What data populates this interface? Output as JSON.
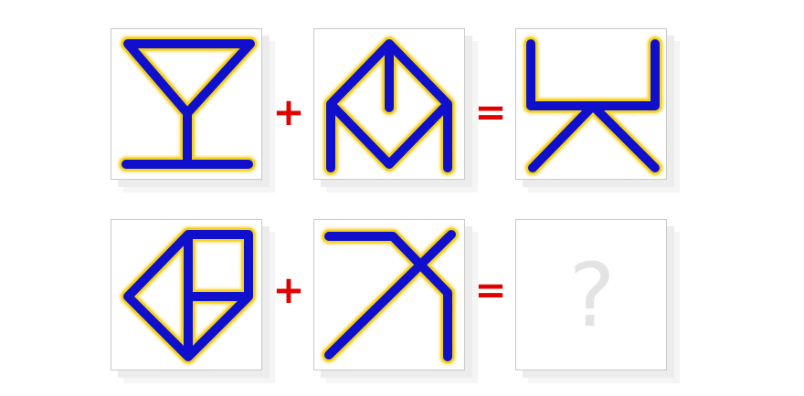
{
  "puzzle": {
    "row1": {
      "plus": "+",
      "equals": "="
    },
    "row2": {
      "plus": "+",
      "equals": "=",
      "answer": "?"
    }
  },
  "colors": {
    "stroke_core": "#1010cc",
    "stroke_glow": "#f2d21b",
    "operator": "#e00000",
    "placeholder": "#e3e3e3"
  },
  "icons": [
    "martini-glass-glyph",
    "envelope-w-glyph",
    "sitting-figure-glyph",
    "kite-grid-glyph",
    "bent-cross-glyph",
    "question-mark"
  ]
}
